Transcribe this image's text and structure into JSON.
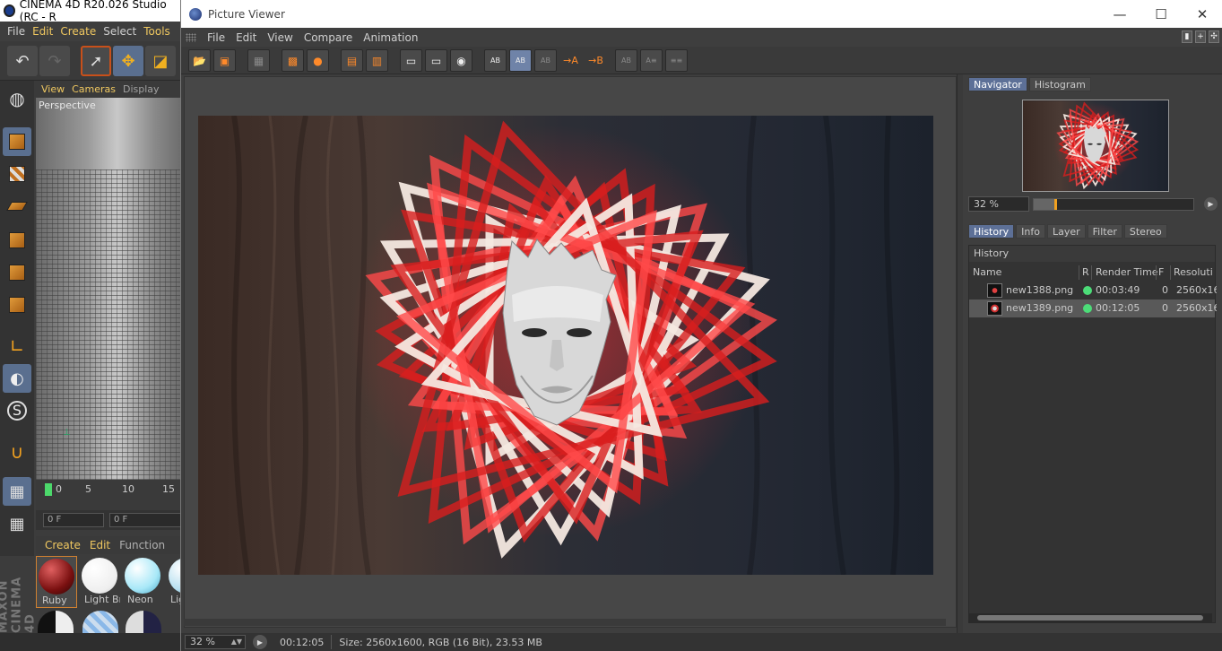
{
  "main_app": {
    "title": "CINEMA 4D R20.026 Studio (RC - R",
    "menu": [
      "File",
      "Edit",
      "Create",
      "Select",
      "Tools"
    ],
    "viewport_menu": [
      "View",
      "Cameras",
      "Display"
    ],
    "viewport_label": "Perspective",
    "timeline_ticks": [
      "0",
      "5",
      "10",
      "15"
    ],
    "frame_start": "0 F",
    "frame_current": "0 F",
    "material_menu": [
      "Create",
      "Edit",
      "Function"
    ],
    "materials": [
      {
        "label": "Ruby",
        "color": "#7a1010"
      },
      {
        "label": "Light Br",
        "color": "#ffffff"
      },
      {
        "label": "Neon",
        "color": "#a8e8f8"
      },
      {
        "label": "Lig",
        "color": "#b8e0f0"
      }
    ],
    "logo_text": "MAXON CINEMA 4D"
  },
  "picture_viewer": {
    "title": "Picture Viewer",
    "window_buttons": {
      "minimize": "—",
      "maximize": "☐",
      "close": "✕"
    },
    "menu": [
      "File",
      "Edit",
      "View",
      "Compare",
      "Animation"
    ],
    "navigator_tabs": [
      "Navigator",
      "Histogram"
    ],
    "navigator_zoom": "32 %",
    "navigator_zoom_fraction": 0.13,
    "info_tabs": [
      "History",
      "Info",
      "Layer",
      "Filter",
      "Stereo"
    ],
    "history_header": "History",
    "history_columns": {
      "name": "Name",
      "r": "R",
      "render_time": "Render Time",
      "f": "F",
      "resolution": "Resoluti"
    },
    "history_rows": [
      {
        "name": "new1388.png",
        "render_time": "00:03:49",
        "f": "0",
        "resolution": "2560x16",
        "selected": false
      },
      {
        "name": "new1389.png",
        "render_time": "00:12:05",
        "f": "0",
        "resolution": "2560x16",
        "selected": true
      }
    ],
    "status": {
      "zoom": "32 %",
      "time": "00:12:05",
      "info": "Size: 2560x1600, RGB (16 Bit), 23.53 MB"
    }
  },
  "colors": {
    "accent_tab": "#5d7097",
    "accent_highlight": "#f0c860",
    "render_dot": "#4cdc78"
  }
}
